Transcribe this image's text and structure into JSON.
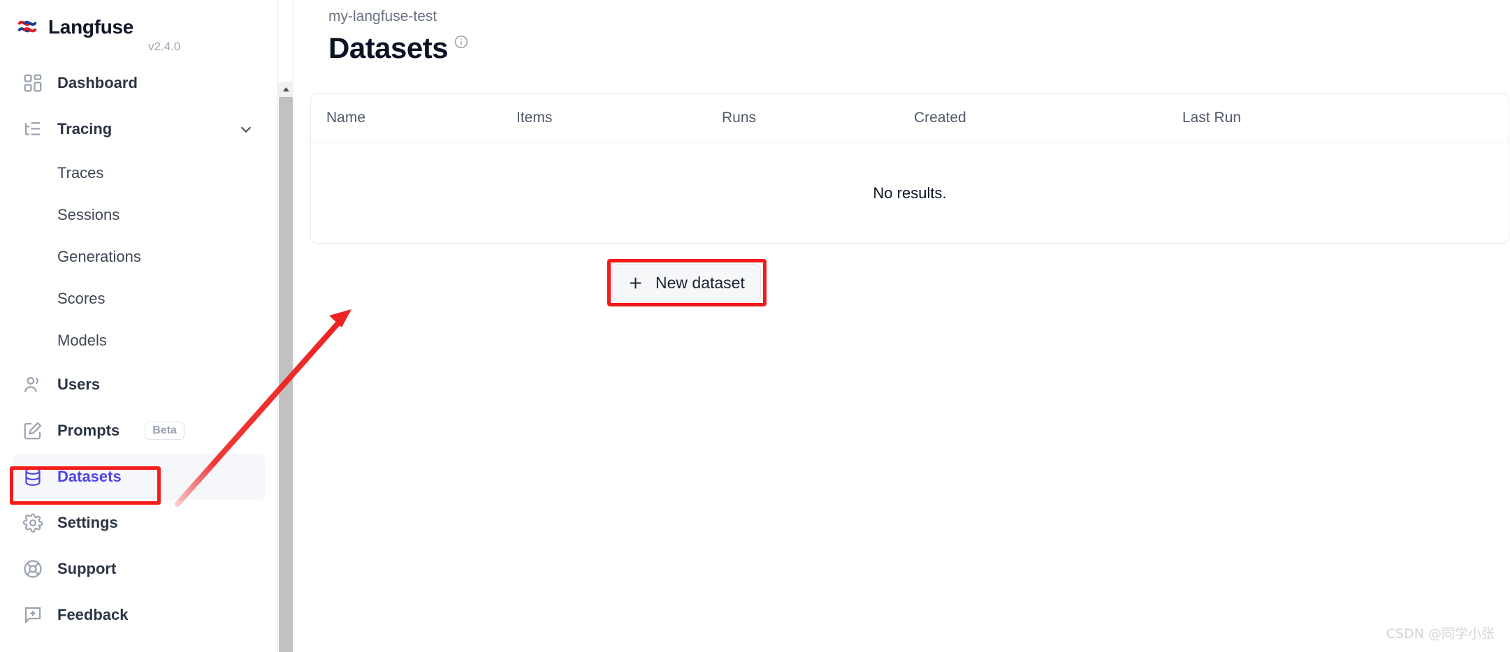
{
  "app": {
    "brand_name": "Langfuse",
    "version": "v2.4.0",
    "logo_icon": "langfuse-logo-icon"
  },
  "sidebar": {
    "items": [
      {
        "label": "Dashboard",
        "icon": "layout-dashboard-icon",
        "type": "item",
        "active": false
      },
      {
        "label": "Tracing",
        "icon": "list-tree-icon",
        "type": "item",
        "active": false,
        "expanded": true,
        "chevron": "chevron-down-icon"
      },
      {
        "label": "Traces",
        "type": "sub",
        "active": false
      },
      {
        "label": "Sessions",
        "type": "sub",
        "active": false
      },
      {
        "label": "Generations",
        "type": "sub",
        "active": false
      },
      {
        "label": "Scores",
        "type": "sub",
        "active": false
      },
      {
        "label": "Models",
        "type": "sub",
        "active": false
      },
      {
        "label": "Users",
        "icon": "users-icon",
        "type": "item",
        "active": false
      },
      {
        "label": "Prompts",
        "icon": "pencil-square-icon",
        "type": "item",
        "active": false,
        "badge": "Beta"
      },
      {
        "label": "Datasets",
        "icon": "database-icon",
        "type": "item",
        "active": true
      },
      {
        "label": "Settings",
        "icon": "gear-icon",
        "type": "item",
        "active": false
      },
      {
        "label": "Support",
        "icon": "lifebuoy-icon",
        "type": "item",
        "active": false
      },
      {
        "label": "Feedback",
        "icon": "message-plus-icon",
        "type": "item",
        "active": false
      }
    ],
    "scrollbar": {
      "arrow_up": "triangle-up-icon"
    }
  },
  "main": {
    "breadcrumb": "my-langfuse-test",
    "page_title": "Datasets",
    "info_icon": "info-circle-icon",
    "table": {
      "columns": [
        "Name",
        "Items",
        "Runs",
        "Created",
        "Last Run"
      ],
      "rows": [],
      "empty_text": "No results."
    },
    "new_dataset_button": {
      "label": "New dataset",
      "icon": "plus-icon"
    }
  },
  "annotations": {
    "highlight_color": "#f41b1b",
    "arrow_color": "#ee2222",
    "targets": [
      "sidebar-item-datasets",
      "new-dataset-button"
    ]
  },
  "watermark": "CSDN @同学小张",
  "colors": {
    "accent": "#4f46e5",
    "text_primary": "#0d1324",
    "text_muted": "#6b7280",
    "border": "#e6eaee",
    "annotation_red": "#f41b1b"
  }
}
